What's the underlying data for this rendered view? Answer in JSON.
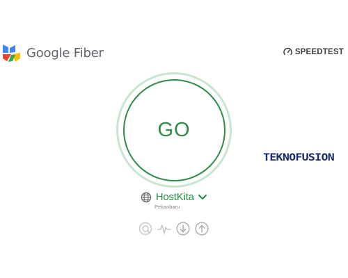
{
  "header": {
    "brand_name": "Google Fiber",
    "speedtest_label": "SPEEDTEST"
  },
  "icons": {
    "brand_logo": "google-fiber-logo",
    "speedtest": "speedometer-icon",
    "globe": "globe-icon",
    "chevron": "chevron-down-icon",
    "ping": "ping-icon",
    "jitter": "jitter-icon",
    "download": "download-icon",
    "upload": "upload-icon"
  },
  "test": {
    "go_label": "GO"
  },
  "server": {
    "name": "HostKita",
    "location": "Pekanbaru"
  },
  "watermark": {
    "text": "TEKNOFUSION"
  },
  "colors": {
    "accent_green": "#2e8b48",
    "ring_light_green": "#c8e6cf",
    "icon_gray": "#b0b4b8",
    "logo_blue": "#4285f4",
    "logo_red": "#ea4335",
    "logo_yellow": "#fbbc05",
    "logo_green": "#34a853"
  }
}
